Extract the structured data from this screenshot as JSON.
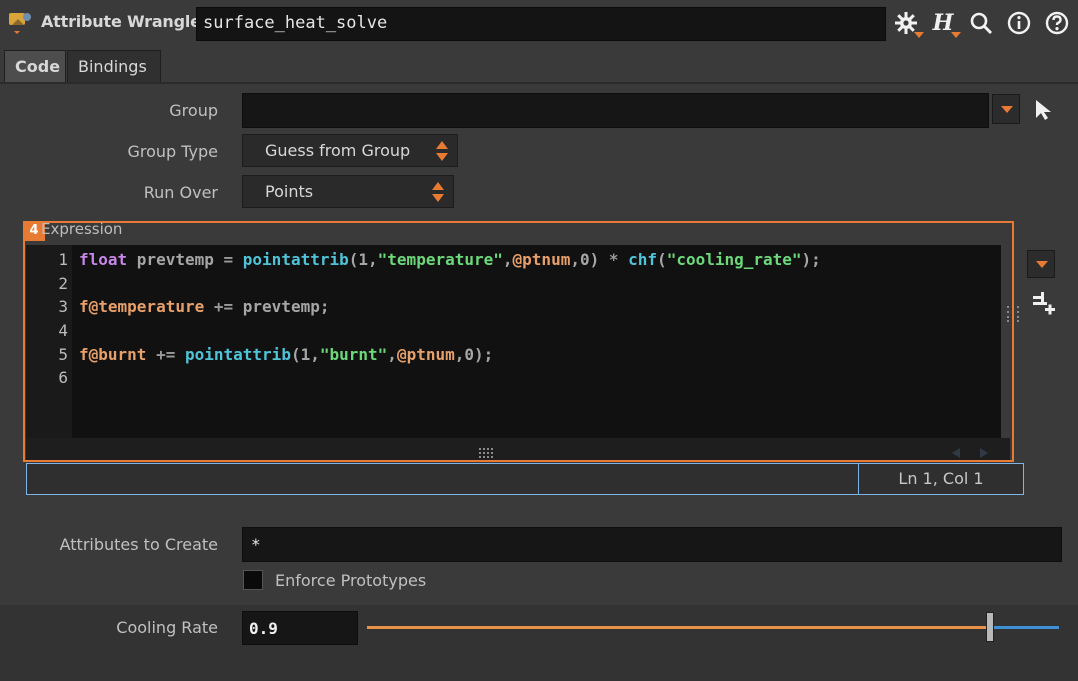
{
  "header": {
    "node_type": "Attribute Wrangle",
    "node_name": "surface_heat_solve",
    "icons": [
      "gear-icon",
      "help-h-icon",
      "search-icon",
      "info-icon",
      "question-icon"
    ],
    "h_label": "H"
  },
  "tabs": [
    {
      "label": "Code",
      "active": true
    },
    {
      "label": "Bindings",
      "active": false
    }
  ],
  "params": {
    "group": {
      "label": "Group",
      "value": ""
    },
    "group_type": {
      "label": "Group Type",
      "value": "Guess from Group"
    },
    "run_over": {
      "label": "Run Over",
      "value": "Points"
    }
  },
  "editor": {
    "badge": "4",
    "title": "Expression",
    "line_numbers": [
      "1",
      "2",
      "3",
      "4",
      "5",
      "6"
    ],
    "status": "Ln 1, Col 1"
  },
  "attributes": {
    "create_label": "Attributes to Create",
    "create_value": "*",
    "enforce_label": "Enforce Prototypes",
    "enforce_checked": false
  },
  "cooling": {
    "label": "Cooling Rate",
    "value": "0.9",
    "slider_fraction": 0.9
  },
  "colors": {
    "accent_orange": "#e87b33",
    "status_blue": "#7fb4e8"
  }
}
